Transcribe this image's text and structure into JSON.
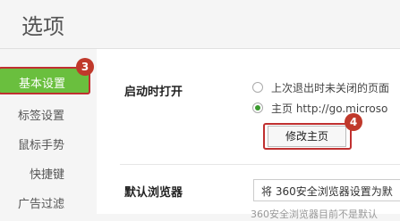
{
  "header": {
    "title": "选项"
  },
  "sidebar": {
    "items": [
      {
        "label": "基本设置",
        "badge": "3"
      },
      {
        "label": "标签设置"
      },
      {
        "label": "鼠标手势"
      },
      {
        "label": "快捷键"
      },
      {
        "label": "广告过滤"
      }
    ]
  },
  "startup": {
    "title": "启动时打开",
    "options": [
      {
        "label": "上次退出时未关闭的页面",
        "checked": false
      },
      {
        "label": "主页   http://go.microso",
        "checked": true
      }
    ],
    "modify_home_button": "修改主页",
    "button_badge": "4"
  },
  "default_browser": {
    "title": "默认浏览器",
    "select_value": "将 360安全浏览器设置为默",
    "hint": "360安全浏览器目前不是默认"
  }
}
